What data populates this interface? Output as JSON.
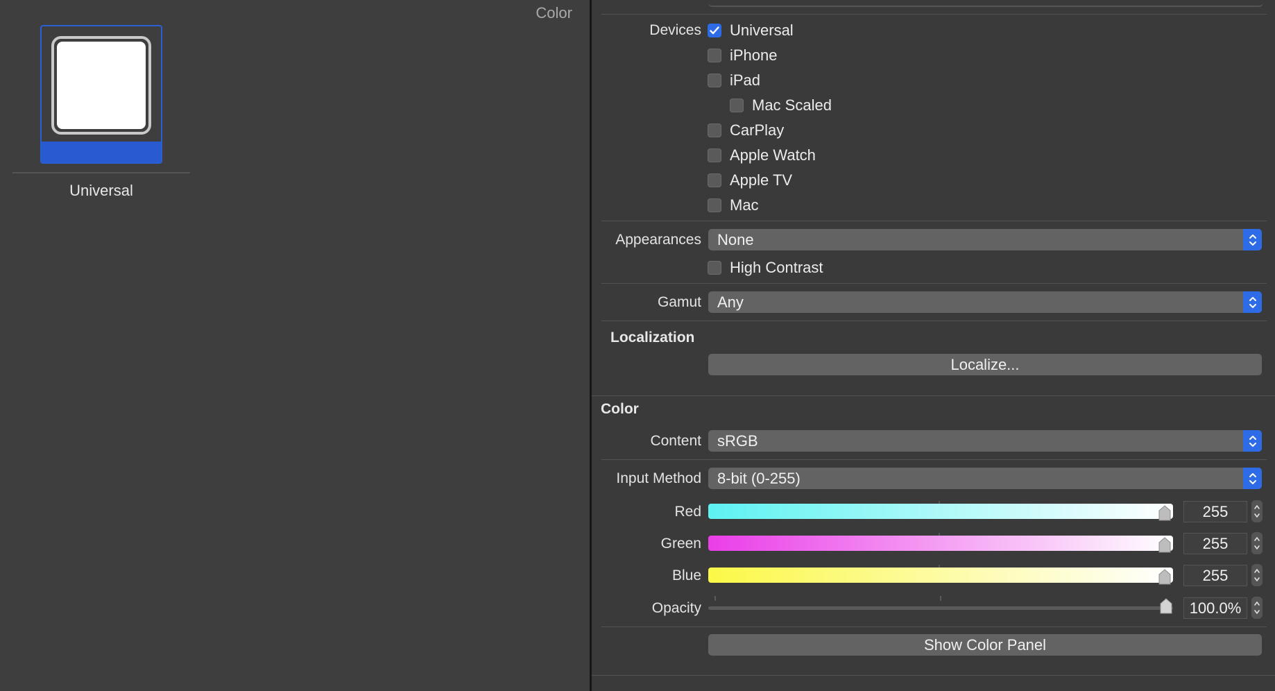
{
  "canvas": {
    "title": "Color",
    "swatch_label": "Universal"
  },
  "devices": {
    "label": "Devices",
    "items": [
      {
        "label": "Universal",
        "checked": true
      },
      {
        "label": "iPhone",
        "checked": false
      },
      {
        "label": "iPad",
        "checked": false
      },
      {
        "label": "Mac Scaled",
        "checked": false
      },
      {
        "label": "CarPlay",
        "checked": false
      },
      {
        "label": "Apple Watch",
        "checked": false
      },
      {
        "label": "Apple TV",
        "checked": false
      },
      {
        "label": "Mac",
        "checked": false
      }
    ]
  },
  "appearances": {
    "label": "Appearances",
    "value": "None",
    "high_contrast": "High Contrast"
  },
  "gamut": {
    "label": "Gamut",
    "value": "Any"
  },
  "localization": {
    "title": "Localization",
    "button": "Localize..."
  },
  "color": {
    "title": "Color",
    "content_label": "Content",
    "content_value": "sRGB",
    "input_label": "Input Method",
    "input_value": "8-bit (0-255)",
    "red_label": "Red",
    "red_value": "255",
    "green_label": "Green",
    "green_value": "255",
    "blue_label": "Blue",
    "blue_value": "255",
    "opacity_label": "Opacity",
    "opacity_value": "100.0%",
    "show_panel": "Show Color Panel"
  },
  "colors": {
    "accent": "#2e6be6",
    "red_track_start": "#5ef2f2",
    "green_track_start": "#ea3ee8",
    "blue_track_start": "#fbf848"
  }
}
